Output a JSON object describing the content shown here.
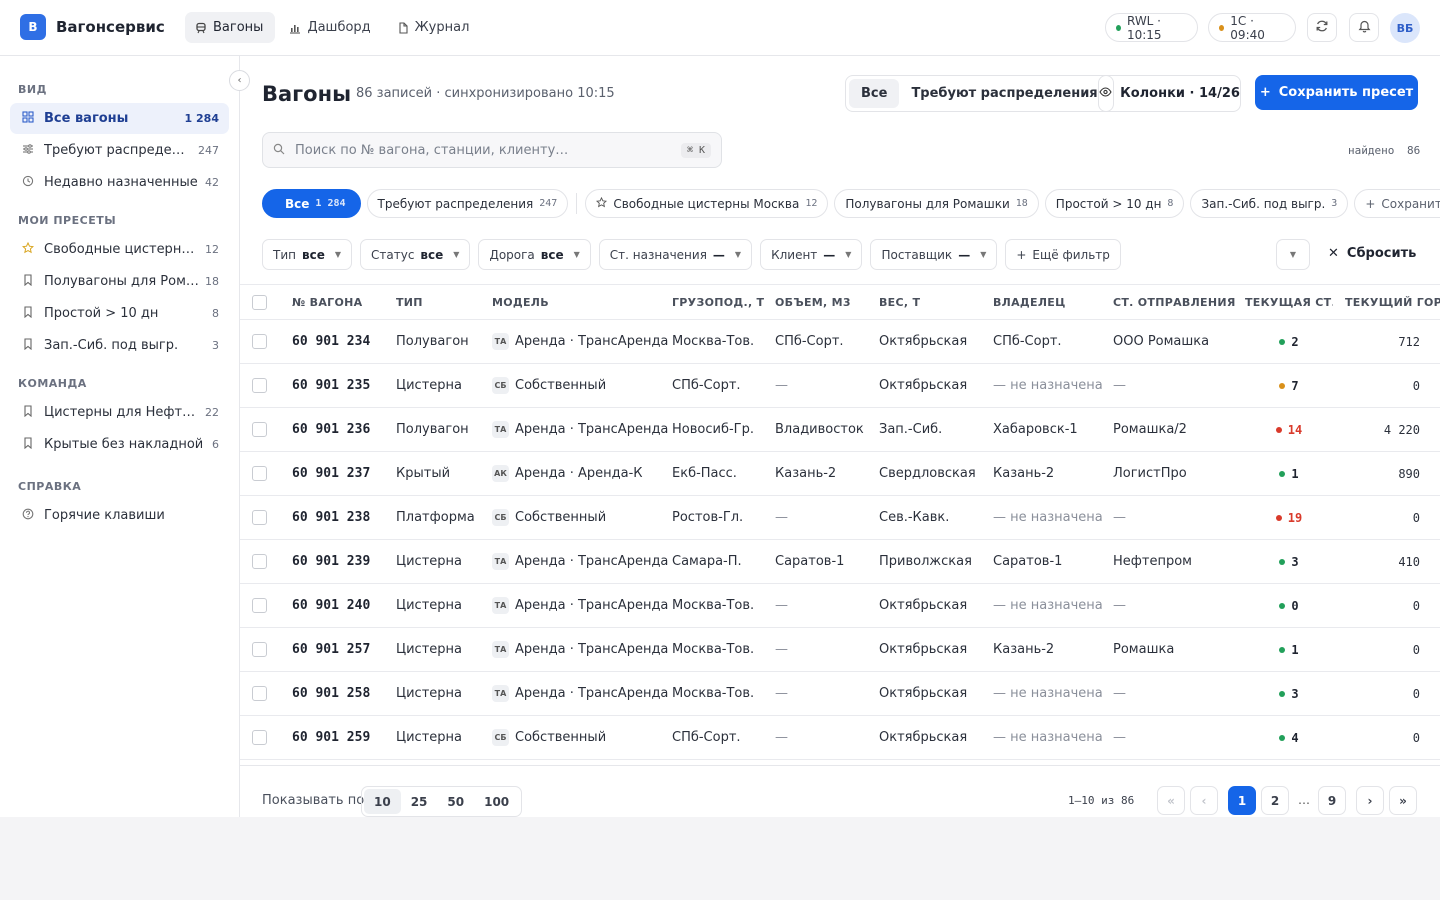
{
  "app": {
    "logo_letter": "В",
    "name": "Вагонсервис"
  },
  "nav": [
    {
      "label": "Вагоны",
      "icon": "railcar-icon",
      "active": true
    },
    {
      "label": "Дашборд",
      "icon": "chart-icon",
      "active": false
    },
    {
      "label": "Журнал",
      "icon": "document-icon",
      "active": false
    }
  ],
  "status": {
    "rwl": {
      "label": "RWL · 10:15",
      "color": "#22a05a"
    },
    "onec": {
      "label": "1С · 09:40",
      "color": "#d9901a"
    }
  },
  "user": {
    "initials": "ВБ"
  },
  "sidebar": {
    "sections": {
      "view": "ВИД",
      "presets": "МОИ ПРЕСЕТЫ",
      "team": "КОМАНДА",
      "help": "СПРАВКА"
    },
    "view_items": [
      {
        "label": "Все вагоны",
        "count": "1 284",
        "icon": "grid-icon",
        "active": true
      },
      {
        "label": "Требуют распределения",
        "count": "247",
        "icon": "sliders-icon",
        "active": false
      },
      {
        "label": "Недавно назначенные",
        "count": "42",
        "icon": "history-icon",
        "active": false
      }
    ],
    "preset_items": [
      {
        "label": "Свободные цистерны Москва",
        "count": "12",
        "icon": "star-icon"
      },
      {
        "label": "Полувагоны для Ромашки",
        "count": "18",
        "icon": "bookmark-icon"
      },
      {
        "label": "Простой > 10 дн",
        "count": "8",
        "icon": "bookmark-icon"
      },
      {
        "label": "Зап.-Сиб. под выгр.",
        "count": "3",
        "icon": "bookmark-icon"
      }
    ],
    "team_items": [
      {
        "label": "Цистерны для Нефтепром",
        "count": "22",
        "icon": "bookmark-icon"
      },
      {
        "label": "Крытые без накладной",
        "count": "6",
        "icon": "bookmark-icon"
      }
    ],
    "help_items": [
      {
        "label": "Горячие клавиши",
        "icon": "help-icon"
      }
    ]
  },
  "page": {
    "title": "Вагоны",
    "subtitle": "86 записей · синхронизировано 10:15",
    "segments": [
      "Все",
      "Требуют распределения"
    ],
    "columns_btn": "Колонки · 14/26",
    "save_btn": "Сохранить пресет",
    "search_placeholder": "Поиск по № вагона, станции, клиенту…",
    "search_kbd": "⌘ K",
    "found_label": "найдено",
    "found_count": "86"
  },
  "chips": [
    {
      "label": "Все",
      "count": "1 284",
      "active": true
    },
    {
      "label": "Требуют распределения",
      "count": "247"
    },
    {
      "label": "Свободные цистерны Москва",
      "count": "12",
      "icon": "star"
    },
    {
      "label": "Полувагоны для Ромашки",
      "count": "18"
    },
    {
      "label": "Простой > 10 дн",
      "count": "8"
    },
    {
      "label": "Зап.-Сиб. под выгр.",
      "count": "3"
    },
    {
      "label": "Сохранить текущий",
      "ghost": true
    }
  ],
  "filters": [
    {
      "name": "Тип",
      "value": "все"
    },
    {
      "name": "Статус",
      "value": "все"
    },
    {
      "name": "Дорога",
      "value": "все"
    },
    {
      "name": "Ст. назначения",
      "value": "—"
    },
    {
      "name": "Клиент",
      "value": "—"
    },
    {
      "name": "Поставщик",
      "value": "—"
    }
  ],
  "more_filter": "Ещё фильтр",
  "reset": "Сбросить",
  "table": {
    "headers": [
      "№ ВАГОНА",
      "ТИП",
      "МОДЕЛЬ",
      "ГРУЗОПОД., Т",
      "ОБЪЕМ, М3",
      "ВЕС, Т",
      "ВЛАДЕЛЕЦ",
      "СТ. ОТПРАВЛЕНИЯ",
      "ТЕКУЩАЯ СТ.",
      "ТЕКУЩИЙ ГОРОД"
    ],
    "rows": [
      [
        "60 901 234",
        "Полувагон",
        "ТА",
        "Аренда · ТрансАренда",
        "Москва-Тов.",
        "СПб-Сорт.",
        "Октябрьская",
        "СПб-Сорт.",
        "ООО Ромашка",
        "2",
        "green",
        "712"
      ],
      [
        "60 901 235",
        "Цистерна",
        "СБ",
        "Собственный",
        "СПб-Сорт.",
        "—",
        "Октябрьская",
        "— не назначена",
        "—",
        "7",
        "orange",
        "0"
      ],
      [
        "60 901 236",
        "Полувагон",
        "ТА",
        "Аренда · ТрансАренда",
        "Новосиб-Гр.",
        "Владивосток",
        "Зап.-Сиб.",
        "Хабаровск-1",
        "Ромашка/2",
        "14",
        "red",
        "4 220"
      ],
      [
        "60 901 237",
        "Крытый",
        "АК",
        "Аренда · Аренда-К",
        "Екб-Пасс.",
        "Казань-2",
        "Свердловская",
        "Казань-2",
        "ЛогистПро",
        "1",
        "green",
        "890"
      ],
      [
        "60 901 238",
        "Платформа",
        "СБ",
        "Собственный",
        "Ростов-Гл.",
        "—",
        "Сев.-Кавк.",
        "— не назначена",
        "—",
        "19",
        "red",
        "0"
      ],
      [
        "60 901 239",
        "Цистерна",
        "ТА",
        "Аренда · ТрансАренда",
        "Самара-П.",
        "Саратов-1",
        "Приволжская",
        "Саратов-1",
        "Нефтепром",
        "3",
        "green",
        "410"
      ],
      [
        "60 901 240",
        "Цистерна",
        "ТА",
        "Аренда · ТрансАренда",
        "Москва-Тов.",
        "—",
        "Октябрьская",
        "— не назначена",
        "—",
        "0",
        "green",
        "0"
      ],
      [
        "60 901 257",
        "Цистерна",
        "ТА",
        "Аренда · ТрансАренда",
        "Москва-Тов.",
        "—",
        "Октябрьская",
        "Казань-2",
        "Ромашка",
        "1",
        "green",
        "0"
      ],
      [
        "60 901 258",
        "Цистерна",
        "ТА",
        "Аренда · ТрансАренда",
        "Москва-Тов.",
        "—",
        "Октябрьская",
        "— не назначена",
        "—",
        "3",
        "green",
        "0"
      ],
      [
        "60 901 259",
        "Цистерна",
        "СБ",
        "Собственный",
        "СПб-Сорт.",
        "—",
        "Октябрьская",
        "— не назначена",
        "—",
        "4",
        "green",
        "0"
      ]
    ]
  },
  "colors": {
    "green": "#22a05a",
    "orange": "#d9901a",
    "red": "#d93a2b",
    "accent": "#1565e8"
  },
  "footer": {
    "show_label": "Показывать по",
    "page_sizes": [
      "10",
      "25",
      "50",
      "100"
    ],
    "range": "1–10 из 86",
    "pages": [
      "1",
      "2",
      "…",
      "9"
    ]
  }
}
